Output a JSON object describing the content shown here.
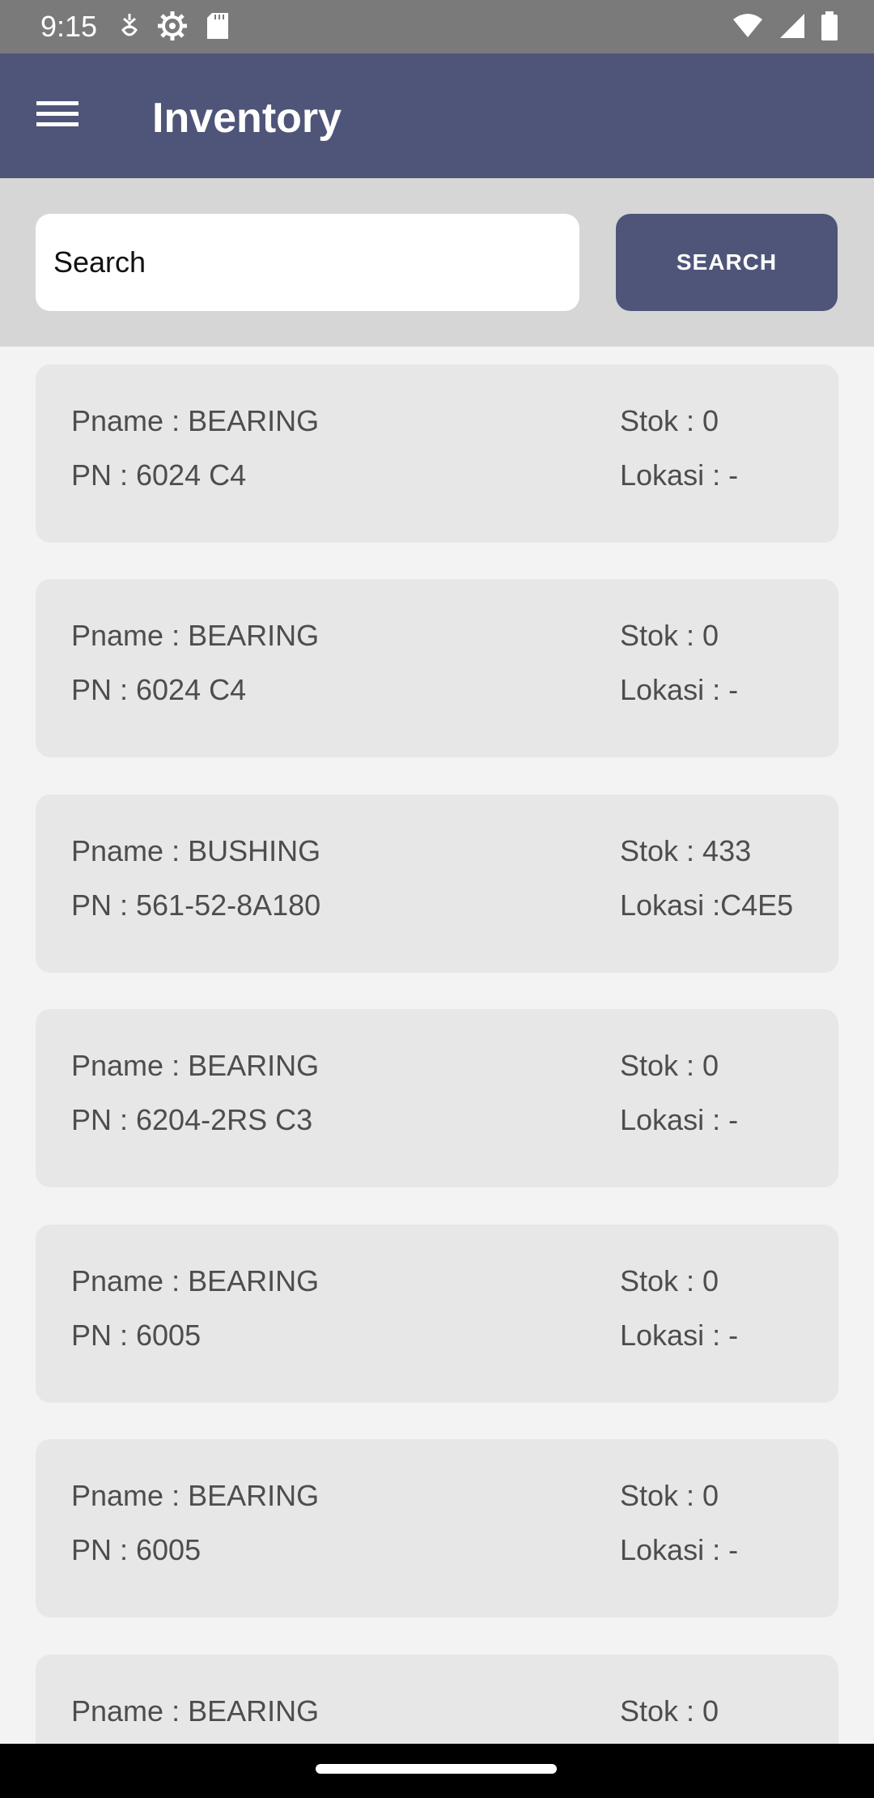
{
  "status_bar": {
    "time": "9:15",
    "left_icons": [
      "data-saver-icon",
      "settings-icon",
      "sd-card-icon"
    ],
    "right_icons": [
      "wifi-icon",
      "signal-icon",
      "battery-icon"
    ]
  },
  "app_bar": {
    "title": "Inventory",
    "menu_icon": "hamburger-menu-icon",
    "color": "#4f5579"
  },
  "search": {
    "placeholder": "Search",
    "button_label": "SEARCH"
  },
  "items": [
    {
      "pname": "Pname : BEARING",
      "pn": "PN : 6024 C4",
      "stok": "Stok : 0",
      "lokasi": "Lokasi : -"
    },
    {
      "pname": "Pname : BEARING",
      "pn": "PN : 6024 C4",
      "stok": "Stok : 0",
      "lokasi": "Lokasi : -"
    },
    {
      "pname": "Pname : BUSHING",
      "pn": "PN : 561-52-8A180",
      "stok": "Stok : 433",
      "lokasi": "Lokasi :C4E5"
    },
    {
      "pname": "Pname : BEARING",
      "pn": "PN : 6204-2RS C3",
      "stok": "Stok : 0",
      "lokasi": "Lokasi : -"
    },
    {
      "pname": "Pname : BEARING",
      "pn": "PN : 6005",
      "stok": "Stok : 0",
      "lokasi": "Lokasi : -"
    },
    {
      "pname": "Pname : BEARING",
      "pn": "PN : 6005",
      "stok": "Stok : 0",
      "lokasi": "Lokasi : -"
    },
    {
      "pname": "Pname : BEARING",
      "pn": "",
      "stok": "Stok : 0",
      "lokasi": ""
    }
  ]
}
